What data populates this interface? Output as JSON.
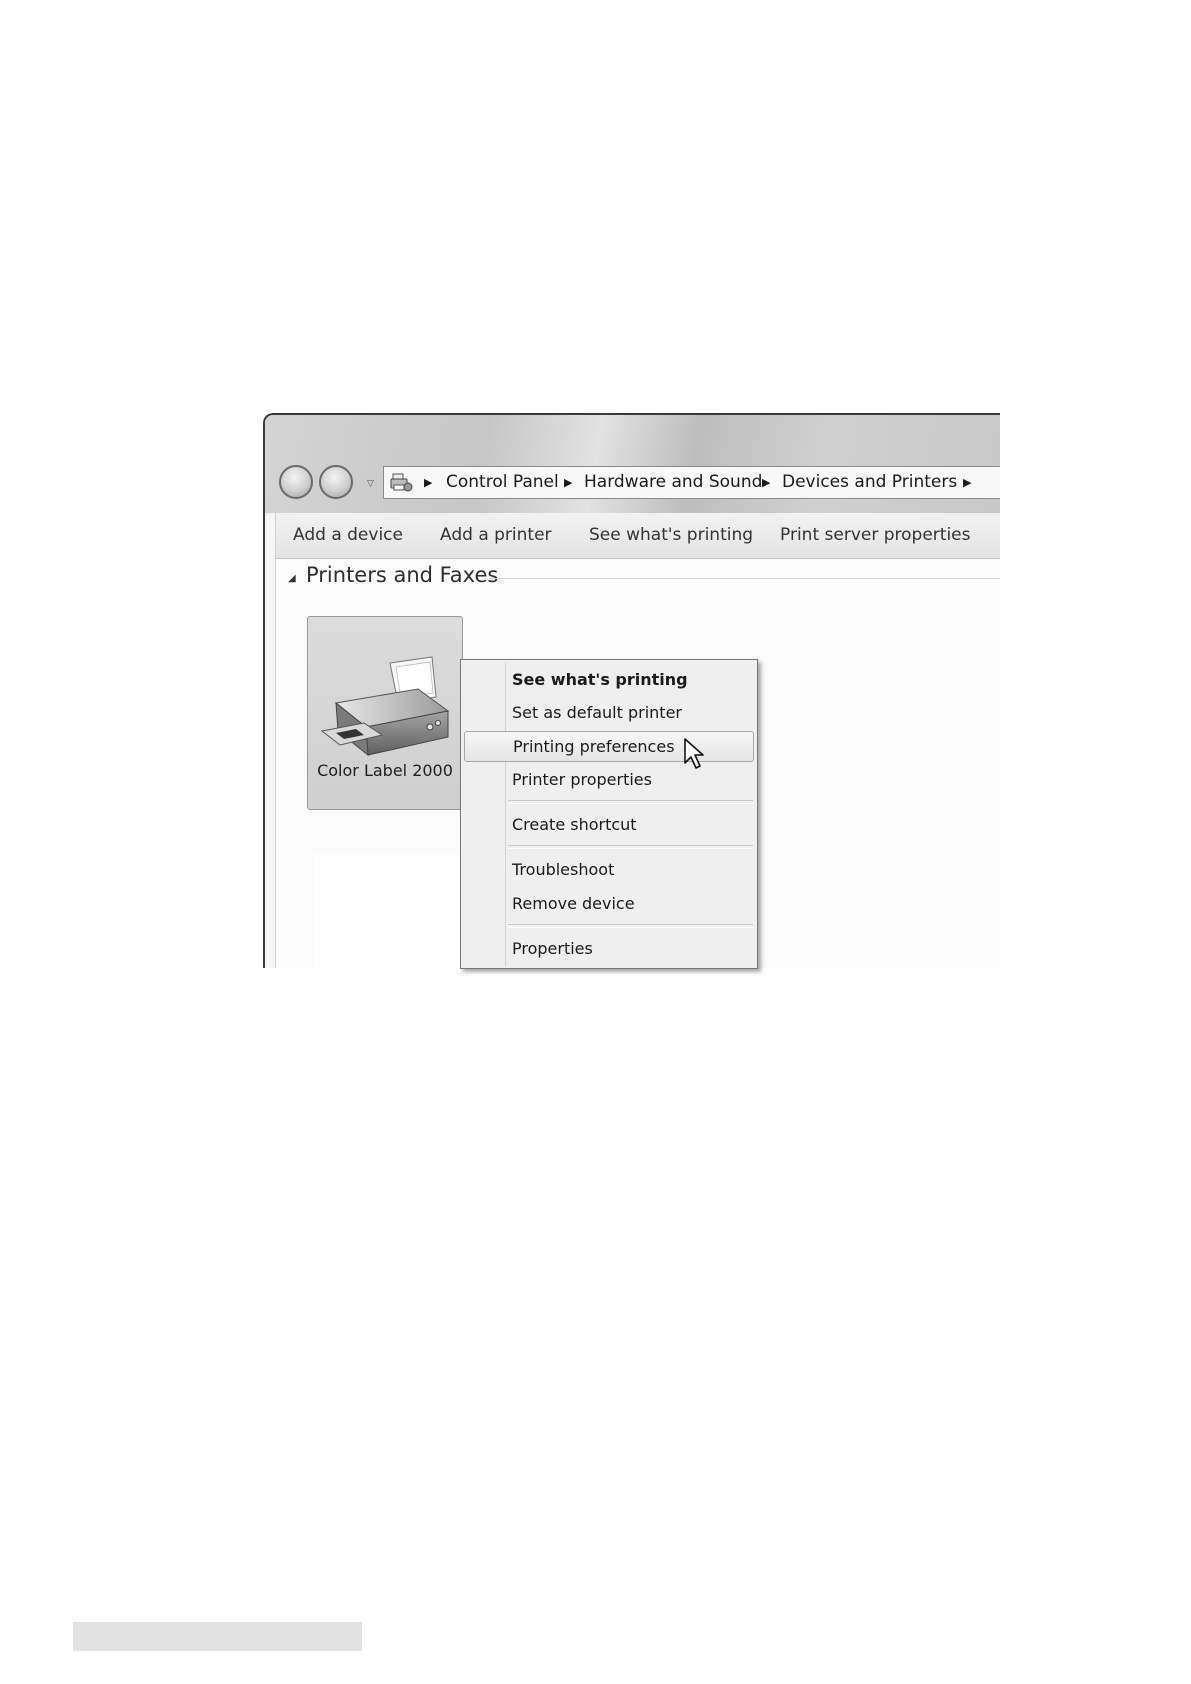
{
  "window": {
    "breadcrumb": [
      {
        "label": "Control Panel"
      },
      {
        "label": "Hardware and Sound"
      },
      {
        "label": "Devices and Printers"
      }
    ]
  },
  "toolbar": {
    "items": [
      {
        "label": "Add a device"
      },
      {
        "label": "Add a printer"
      },
      {
        "label": "See what's printing"
      },
      {
        "label": "Print server properties"
      }
    ]
  },
  "group": {
    "title": "Printers and Faxes"
  },
  "device": {
    "label": "Color Label 2000",
    "icon": "printer-icon"
  },
  "context_menu": {
    "items": [
      {
        "label": "See what's printing",
        "default": true
      },
      {
        "label": "Set as default printer"
      },
      {
        "label": "Printing preferences",
        "hover": true
      },
      {
        "label": "Printer properties"
      },
      {
        "label": "Create shortcut"
      },
      {
        "label": "Troubleshoot"
      },
      {
        "label": "Remove device"
      },
      {
        "label": "Properties"
      }
    ]
  }
}
